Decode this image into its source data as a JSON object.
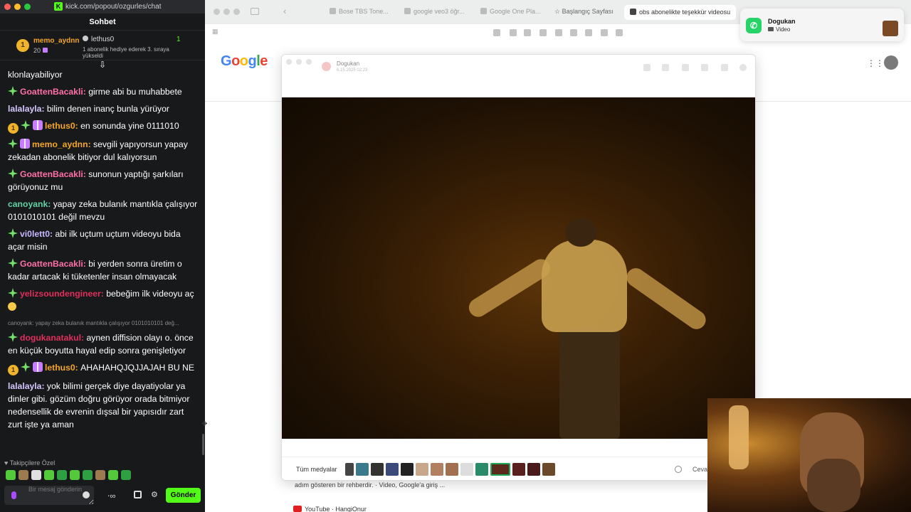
{
  "chat_window": {
    "url": "kick.com/popout/ozgurles/chat",
    "header": "Sohbet",
    "pinned": {
      "user1": "memo_aydnn",
      "user1_badge": "1",
      "user1_count": "20",
      "user2": "lethus0",
      "user2_count": "1",
      "message": "1 abonelik hediye ederek 3. sıraya yükseldi"
    },
    "messages": [
      {
        "user": "",
        "text": "klonlayabiliyor"
      },
      {
        "user": "GoattenBacakli",
        "text": "girme abi bu muhabbete"
      },
      {
        "user": "lalalayla",
        "text": "bilim denen inanç bunla yürüyor"
      },
      {
        "user": "lethus0",
        "badge": "1",
        "text": "en sonunda yine 0111010"
      },
      {
        "user": "memo_aydnn",
        "text": "sevgili yapıyorsun yapay zekadan abonelik bitiyor dul kalıyorsun"
      },
      {
        "user": "GoattenBacakli",
        "text": "sunonun yaptığı şarkıları görüyonuz mu"
      },
      {
        "user": "canoyank",
        "text": "yapay zeka bulanık mantıkla çalışıyor 0101010101 değil mevzu"
      },
      {
        "user": "vi0lett0",
        "text": "abi ilk uçtum uçtum videoyu bida açar misin"
      },
      {
        "user": "GoattenBacakli",
        "text": "bi yerden sonra üretim o kadar artacak ki tüketenler insan olmayacak"
      },
      {
        "user": "yelizsoundengineer",
        "text": "bebeğim ilk videoyu aç"
      },
      {
        "reply": "canoyank: yapay zeka bulanık mantıkla çalışıyor 0101010101 değ...",
        "user": "dogukanatakul",
        "text": "aynen diffision olayı o. önce en küçük boyutta hayal edip sonra genişletiyor"
      },
      {
        "user": "lethus0",
        "badge": "1",
        "text": "AHAHAHQJQJJAJAH BU NE"
      },
      {
        "user": "lalalayla",
        "text": "yok bilimi gerçek diye dayatiyolar ya dinler gibi. gözüm doğru görüyor orada bitmiyor nedensellik de evrenin dışsal bir yapısıdır zart zurt işte ya aman"
      }
    ],
    "follower_label": "Takipçilere Özel",
    "input_placeholder": "Bir mesaj gönderin",
    "send_label": "Gönder",
    "brand_color": "#53fc18"
  },
  "browser": {
    "tabs": [
      {
        "label": "Bose TBS Tone..."
      },
      {
        "label": "google veo3 öğr..."
      },
      {
        "label": "Google One Pla..."
      },
      {
        "label": "Başlangıç Sayfası"
      },
      {
        "label": "obs abonelikte teşekkür videosu"
      }
    ],
    "google_logo": "Google",
    "snippet1": "adım gösteren bir rehberdir. · Video, Google'a giriş ...",
    "snippet2": "YouTube · HangiOnur"
  },
  "viewer": {
    "contact": "Dogukan",
    "date": "6.15.2025 02:23",
    "all_media_label": "Tüm medyalar",
    "reply_label": "Cevap"
  },
  "notification": {
    "app": "WhatsApp",
    "title": "Dogukan",
    "subtitle": "Video"
  }
}
